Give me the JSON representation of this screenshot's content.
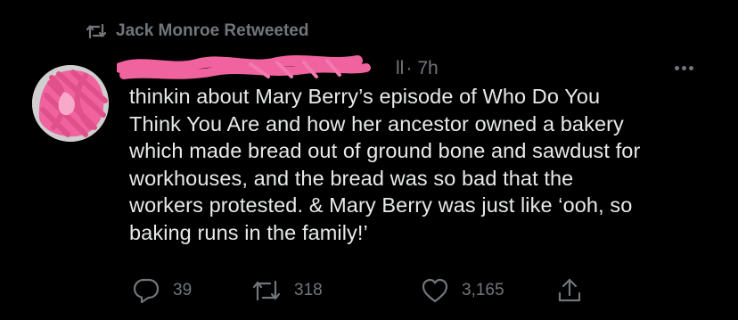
{
  "retweet_header": {
    "label": "Jack Monroe Retweeted",
    "icon": "retweet-icon"
  },
  "tweet": {
    "handle_fragment": "ll",
    "separator": "·",
    "time": "7h",
    "text_lines": [
      "thinkin about Mary Berry’s episode of Who Do You",
      "Think You Are and how her ancestor owned a bakery",
      "which made bread out of ground bone and sawdust for",
      "workhouses, and the bread was so bad that the",
      "workers protested. & Mary Berry was just like ‘ooh, so",
      "baking runs in the family!’"
    ]
  },
  "actions": {
    "replies": "39",
    "retweets": "318",
    "likes": "3,165",
    "icons": [
      "reply-icon",
      "retweet-icon",
      "like-icon",
      "share-icon"
    ]
  },
  "colors": {
    "background": "#000000",
    "text": "#e7e9ea",
    "secondary": "#71767b",
    "redaction": "#f0639e"
  }
}
